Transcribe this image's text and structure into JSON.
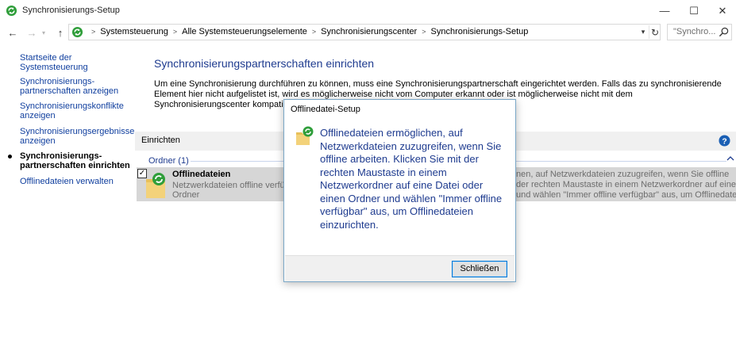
{
  "window": {
    "title": "Synchronisierungs-Setup",
    "minimize_glyph": "—",
    "maximize_glyph": "☐",
    "close_glyph": "✕"
  },
  "address": {
    "breadcrumbs": [
      "Systemsteuerung",
      "Alle Systemsteuerungselemente",
      "Synchronisierungscenter",
      "Synchronisierungs-Setup"
    ],
    "search_placeholder": "\"Synchro..."
  },
  "nav_glyphs": {
    "back": "←",
    "forward": "→",
    "dropdown": "▾",
    "up": "↑",
    "refresh": "↻"
  },
  "sidebar": {
    "items": [
      {
        "label": "Startseite der Systemsteuerung",
        "active": false
      },
      {
        "label": "Synchronisierungs-partnerschaften anzeigen",
        "active": false
      },
      {
        "label": "Synchronisierungskonflikte anzeigen",
        "active": false
      },
      {
        "label": "Synchronisierungsergebnisse anzeigen",
        "active": false
      },
      {
        "label": "Synchronisierungs-partnerschaften einrichten",
        "active": true
      },
      {
        "label": "Offlinedateien verwalten",
        "active": false
      }
    ]
  },
  "main": {
    "title": "Synchronisierungspartnerschaften einrichten",
    "description": "Um eine Synchronisierung durchführen zu können, muss eine Synchronisierungspartnerschaft eingerichtet werden. Falls das zu synchronisierende Element hier nicht aufgelistet ist, wird es möglicherweise nicht vom Computer erkannt oder ist möglicherweise nicht mit dem Synchronisierungscenter kompatibel.",
    "section_label": "Einrichten",
    "group_label": "Ordner (1)",
    "item": {
      "title": "Offlinedateien",
      "subtitle_line1": "Netzwerkdateien offline verfügb",
      "subtitle_line2": "Ordner",
      "detail_line1": "nen, auf Netzwerkdateien zuzugreifen, wenn Sie offline",
      "detail_line2": "der rechten Maustaste in einem Netzwerkordner auf eine",
      "detail_line3": "und wählen \"Immer offline verfügbar\" aus, um Offlinedatei...",
      "checked": true,
      "check_glyph": "✓"
    }
  },
  "dialog": {
    "title": "Offlinedatei-Setup",
    "message": "Offlinedateien ermöglichen, auf Netzwerkdateien zuzugreifen, wenn Sie offline arbeiten. Klicken Sie mit der rechten Maustaste in einem Netzwerkordner auf eine Datei oder einen Ordner und wählen \"Immer offline verfügbar\" aus, um Offlinedateien einzurichten.",
    "close_button": "Schließen"
  },
  "colors": {
    "link": "#0f3e9e",
    "heading": "#1e3b8f",
    "sync_green": "#2f9e3a",
    "folder_yellow": "#e8c05a",
    "help_blue": "#1a5fb4"
  }
}
